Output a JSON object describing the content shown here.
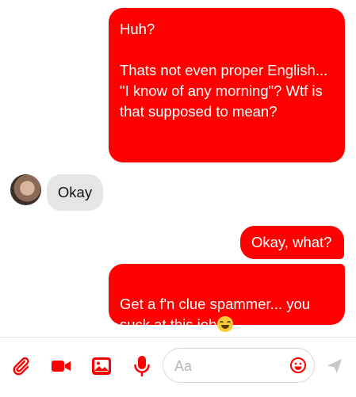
{
  "conversation": {
    "messages": [
      {
        "direction": "outgoing",
        "text": "Huh?\n\nThats not even proper English...\n\"I know of any morning\"? Wtf is that supposed to mean?"
      },
      {
        "direction": "incoming",
        "text": "Okay"
      },
      {
        "direction": "outgoing",
        "text": "Okay, what?"
      },
      {
        "direction": "outgoing",
        "text": "Get a f'n clue spammer... you suck at this job",
        "emoji": "rolling-on-floor-laughing-emoji"
      }
    ]
  },
  "composer": {
    "placeholder": "Aa",
    "value": ""
  },
  "icons": {
    "attach": "paperclip-icon",
    "video": "video-camera-icon",
    "photo": "image-icon",
    "mic": "microphone-icon",
    "emoji": "smiley-icon",
    "send": "send-icon"
  },
  "colors": {
    "outgoing_bubble": "#ff0000",
    "incoming_bubble": "#e5e5e5",
    "accent": "#ff0000",
    "send_icon": "#c9c9c9"
  }
}
